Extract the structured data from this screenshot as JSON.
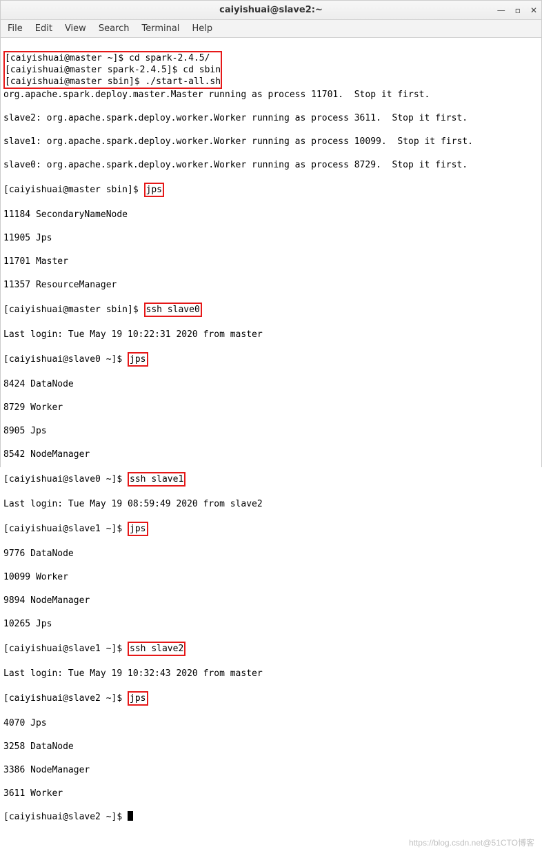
{
  "window": {
    "title": "caiyishuai@slave2:~",
    "min": "—",
    "max": "▫",
    "close": "✕"
  },
  "menu": {
    "file": "File",
    "edit": "Edit",
    "view": "View",
    "search": "Search",
    "terminal": "Terminal",
    "help": "Help"
  },
  "block1": {
    "l1_prompt": "[caiyishuai@master ~]$ ",
    "l1_cmd": "cd spark-2.4.5/",
    "l2_prompt": "[caiyishuai@master spark-2.4.5]$ ",
    "l2_cmd": "cd sbin",
    "l3_prompt": "[caiyishuai@master sbin]$ ",
    "l3_cmd": "./start-all.sh"
  },
  "out1a": "org.apache.spark.deploy.master.Master running as process 11701.  Stop it first.",
  "out1b": "slave2: org.apache.spark.deploy.worker.Worker running as process 3611.  Stop it first.",
  "out1c": "slave1: org.apache.spark.deploy.worker.Worker running as process 10099.  Stop it first.",
  "out1d": "slave0: org.apache.spark.deploy.worker.Worker running as process 8729.  Stop it first.",
  "p_master_sbin": "[caiyishuai@master sbin]$ ",
  "cmd_jps": "jps",
  "jps_m1": "11184 SecondaryNameNode",
  "jps_m2": "11905 Jps",
  "jps_m3": "11701 Master",
  "jps_m4": "11357 ResourceManager",
  "cmd_ssh0": "ssh slave0",
  "login0": "Last login: Tue May 19 10:22:31 2020 from master",
  "p_slave0": "[caiyishuai@slave0 ~]$ ",
  "jps_s0_1": "8424 DataNode",
  "jps_s0_2": "8729 Worker",
  "jps_s0_3": "8905 Jps",
  "jps_s0_4": "8542 NodeManager",
  "cmd_ssh1": "ssh slave1",
  "login1": "Last login: Tue May 19 08:59:49 2020 from slave2",
  "p_slave1": "[caiyishuai@slave1 ~]$ ",
  "jps_s1_1": "9776 DataNode",
  "jps_s1_2": "10099 Worker",
  "jps_s1_3": "9894 NodeManager",
  "jps_s1_4": "10265 Jps",
  "cmd_ssh2": "ssh slave2",
  "login2": "Last login: Tue May 19 10:32:43 2020 from master",
  "p_slave2": "[caiyishuai@slave2 ~]$ ",
  "jps_s2_1": "4070 Jps",
  "jps_s2_2": "3258 DataNode",
  "jps_s2_3": "3386 NodeManager",
  "jps_s2_4": "3611 Worker",
  "watermark": "https://blog.csdn.net@51CTO博客"
}
